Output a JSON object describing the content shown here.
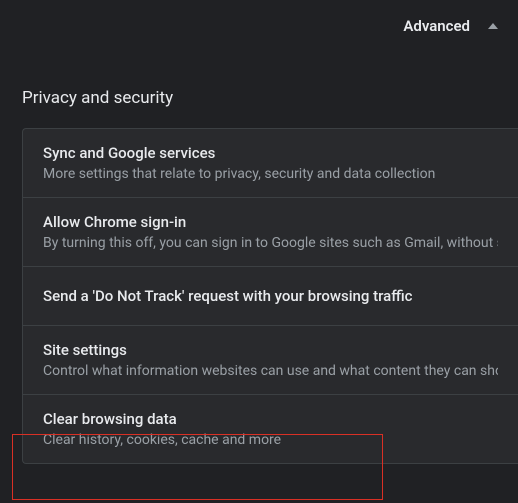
{
  "topbar": {
    "advanced_label": "Advanced"
  },
  "section": {
    "title": "Privacy and security"
  },
  "rows": [
    {
      "title": "Sync and Google services",
      "desc": "More settings that relate to privacy, security and data collection"
    },
    {
      "title": "Allow Chrome sign-in",
      "desc": "By turning this off, you can sign in to Google sites such as Gmail, without signing in to Chrome"
    },
    {
      "title": "Send a 'Do Not Track' request with your browsing traffic",
      "desc": ""
    },
    {
      "title": "Site settings",
      "desc": "Control what information websites can use and what content they can show you"
    },
    {
      "title": "Clear browsing data",
      "desc": "Clear history, cookies, cache and more"
    }
  ]
}
